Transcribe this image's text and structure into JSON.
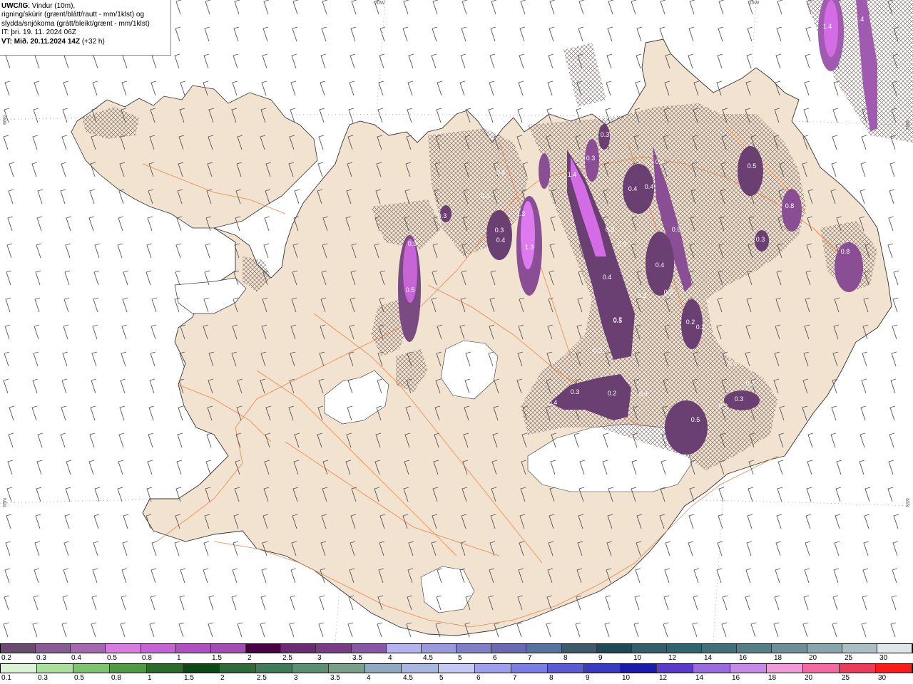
{
  "header": {
    "title": "UWC/IG",
    "title_rest": ": Vindur (10m),",
    "line2": "rigning/skúrir (grænt/blátt/rautt - mm/1klst) og",
    "line3": "slydda/snjókoma (grátt/bleikt/grænt - mm/1klst)",
    "it_line": "IT: þri. 19. 11. 2024 06Z",
    "vt_label": "VT: Mið. 20.11.2024 14Z",
    "vt_offset": " (+32 h)"
  },
  "grid_labels": {
    "lon_20w": "20W",
    "lon_15w": "15W",
    "lat_66n_left": "66N",
    "lat_65n_left": "65N",
    "lat_66n_right": "66N",
    "lat_65n_right": "65N"
  },
  "map_labels": [
    "0.9",
    "0.5",
    "1.3",
    "1.3",
    "0.3",
    "0.4",
    "0.3",
    "0.3",
    "0.4",
    "1.4",
    "0.4",
    "0.6",
    "0.4",
    "0.5",
    "0.4",
    "0.3",
    "0.3",
    "0.4",
    "0.4",
    "0.3",
    "0.7",
    "0.3",
    "0.2",
    "0.2",
    "0.8",
    "0.3",
    "0.8",
    "0.5",
    "0.3",
    "0.3",
    "0.2",
    "0.4",
    "0.2",
    "0.3",
    "0.2",
    "0.4",
    "0.5",
    "0.2",
    "0.3",
    "0.3",
    "1.4",
    "1.4"
  ],
  "snow_scale": {
    "labels": [
      "0.2",
      "0.3",
      "0.4",
      "0.5",
      "0.8",
      "1",
      "1.5",
      "2",
      "2.5",
      "3",
      "3.5",
      "4",
      "4.5",
      "5",
      "6",
      "7",
      "8",
      "9",
      "10",
      "12",
      "14",
      "16",
      "18",
      "20",
      "25",
      "30"
    ],
    "colors": [
      "#6b4a70",
      "#8a5a94",
      "#a567b0",
      "#d67be0",
      "#c563d6",
      "#b04fc2",
      "#a24bb3",
      "#4a0044",
      "#6a2a74",
      "#7a3a86",
      "#8a55a8",
      "#b3b3f0",
      "#9999dd",
      "#7f7fc8",
      "#6a6ab4",
      "#55739f",
      "#3b5a6a",
      "#1d4a54",
      "#335f6a",
      "#2e6470",
      "#3f6f7a",
      "#557f88",
      "#6c9098",
      "#87a7ad",
      "#a9bfc3",
      "#dfe6e7"
    ]
  },
  "rain_scale": {
    "labels": [
      "0.1",
      "0.3",
      "0.5",
      "0.8",
      "1",
      "1.5",
      "2",
      "2.5",
      "3",
      "3.5",
      "4",
      "4.5",
      "5",
      "6",
      "7",
      "8",
      "9",
      "10",
      "12",
      "14",
      "16",
      "18",
      "20",
      "25",
      "30"
    ],
    "colors": [
      "#d9f5d4",
      "#a8e09c",
      "#7dc46f",
      "#4f9a45",
      "#2a6d29",
      "#0b4a12",
      "#2d6a3a",
      "#3e7b58",
      "#5b8f73",
      "#789f8a",
      "#8faac0",
      "#a7b8e0",
      "#c4c8f5",
      "#9f9ff0",
      "#7c7ce6",
      "#5a5ad6",
      "#3a3ac4",
      "#1a1ab0",
      "#5a3acc",
      "#9a6ae0",
      "#c88ae8",
      "#f09ad8",
      "#f46aa0",
      "#f03a5a",
      "#ff1a1a"
    ]
  },
  "colors": {
    "land": "#f2e3d1",
    "glacier": "#ffffff",
    "roads": "#f07a3c",
    "wind_barb": "#555555",
    "precip_light": "#6a4a6e",
    "precip_mid": "#b75ac4",
    "precip_heavy": "#e07af0"
  }
}
